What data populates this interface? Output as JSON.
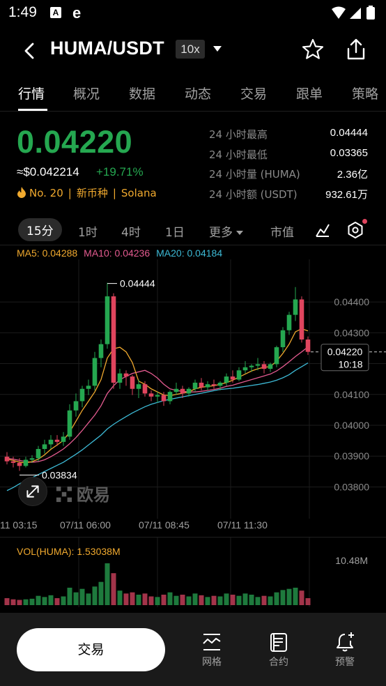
{
  "status_bar": {
    "time": "1:49",
    "icon_a": "A",
    "icon_e": "e"
  },
  "header": {
    "pair": "HUMA/USDT",
    "leverage": "10x"
  },
  "tabs": [
    "行情",
    "概况",
    "数据",
    "动态",
    "交易",
    "跟单",
    "策略"
  ],
  "price": {
    "last": "0.04220",
    "usd": "≈$0.042214",
    "change": "+19.71%",
    "rank": "No. 20",
    "tag": "新币种",
    "chain": "Solana"
  },
  "stats": [
    {
      "label": "24 小时最高",
      "value": "0.04444"
    },
    {
      "label": "24 小时最低",
      "value": "0.03365"
    },
    {
      "label": "24 小时量 (HUMA)",
      "value": "2.36亿"
    },
    {
      "label": "24 小时额 (USDT)",
      "value": "932.61万"
    }
  ],
  "intervals": {
    "i15m": "15分",
    "i1h": "1时",
    "i4h": "4时",
    "i1d": "1日",
    "more": "更多",
    "market": "市值"
  },
  "ma_legend": {
    "ma5": "MA5: 0.04288",
    "ma10": "MA10: 0.04236",
    "ma20": "MA20: 0.04184"
  },
  "watermark": "欧易",
  "price_axis": [
    "0.04400",
    "0.04300",
    "0.04100",
    "0.04000",
    "0.03900",
    "0.03800"
  ],
  "current_price_tag": {
    "price": "0.04220",
    "countdown": "10:18"
  },
  "high_marker": "0.04444",
  "low_marker": "0.03834",
  "time_axis": [
    "11 03:15",
    "07/11 06:00",
    "07/11 08:45",
    "07/11 11:30"
  ],
  "volume": {
    "legend": "VOL(HUMA): 1.53038M",
    "max": "10.48M"
  },
  "bottom": {
    "trade": "交易",
    "grid": "网格",
    "contract": "合约",
    "alert": "预警"
  },
  "colors": {
    "up": "#25a750",
    "down": "#e0455e",
    "ma5": "#f0a92e",
    "ma10": "#e45b90",
    "ma20": "#3dbad6"
  },
  "chart_data": {
    "type": "candlestick",
    "interval": "15分",
    "y_range": [
      0.0374,
      0.0452
    ],
    "candles": [
      {
        "o": 0.0388,
        "h": 0.03895,
        "l": 0.03855,
        "c": 0.03865
      },
      {
        "o": 0.03865,
        "h": 0.0388,
        "l": 0.03845,
        "c": 0.0386
      },
      {
        "o": 0.0386,
        "h": 0.03875,
        "l": 0.03834,
        "c": 0.0385
      },
      {
        "o": 0.0385,
        "h": 0.0388,
        "l": 0.03845,
        "c": 0.0387
      },
      {
        "o": 0.0387,
        "h": 0.03885,
        "l": 0.0386,
        "c": 0.03875
      },
      {
        "o": 0.03875,
        "h": 0.03915,
        "l": 0.03865,
        "c": 0.03905
      },
      {
        "o": 0.03905,
        "h": 0.03935,
        "l": 0.0389,
        "c": 0.0392
      },
      {
        "o": 0.0392,
        "h": 0.0395,
        "l": 0.03905,
        "c": 0.03935
      },
      {
        "o": 0.03935,
        "h": 0.0395,
        "l": 0.03915,
        "c": 0.03928
      },
      {
        "o": 0.03928,
        "h": 0.0396,
        "l": 0.03915,
        "c": 0.03945
      },
      {
        "o": 0.03945,
        "h": 0.0405,
        "l": 0.03935,
        "c": 0.0403
      },
      {
        "o": 0.0403,
        "h": 0.04085,
        "l": 0.0401,
        "c": 0.0406
      },
      {
        "o": 0.0406,
        "h": 0.0411,
        "l": 0.0404,
        "c": 0.041
      },
      {
        "o": 0.041,
        "h": 0.0413,
        "l": 0.0408,
        "c": 0.0411
      },
      {
        "o": 0.0411,
        "h": 0.0422,
        "l": 0.04095,
        "c": 0.042
      },
      {
        "o": 0.042,
        "h": 0.0426,
        "l": 0.0417,
        "c": 0.04245
      },
      {
        "o": 0.04245,
        "h": 0.04444,
        "l": 0.0423,
        "c": 0.044
      },
      {
        "o": 0.044,
        "h": 0.0441,
        "l": 0.041,
        "c": 0.0412
      },
      {
        "o": 0.0412,
        "h": 0.04165,
        "l": 0.041,
        "c": 0.0415
      },
      {
        "o": 0.0415,
        "h": 0.0416,
        "l": 0.0411,
        "c": 0.0414
      },
      {
        "o": 0.0414,
        "h": 0.04145,
        "l": 0.0408,
        "c": 0.041
      },
      {
        "o": 0.041,
        "h": 0.0413,
        "l": 0.0407,
        "c": 0.04115
      },
      {
        "o": 0.04115,
        "h": 0.04125,
        "l": 0.04075,
        "c": 0.04085
      },
      {
        "o": 0.04085,
        "h": 0.04095,
        "l": 0.0406,
        "c": 0.04075
      },
      {
        "o": 0.04075,
        "h": 0.0409,
        "l": 0.04055,
        "c": 0.0408
      },
      {
        "o": 0.0408,
        "h": 0.0409,
        "l": 0.04045,
        "c": 0.0406
      },
      {
        "o": 0.0406,
        "h": 0.04095,
        "l": 0.0405,
        "c": 0.0409
      },
      {
        "o": 0.0409,
        "h": 0.0412,
        "l": 0.0408,
        "c": 0.041
      },
      {
        "o": 0.041,
        "h": 0.0411,
        "l": 0.0407,
        "c": 0.04085
      },
      {
        "o": 0.04085,
        "h": 0.04105,
        "l": 0.04075,
        "c": 0.041
      },
      {
        "o": 0.041,
        "h": 0.0413,
        "l": 0.0409,
        "c": 0.0412
      },
      {
        "o": 0.0412,
        "h": 0.04135,
        "l": 0.04095,
        "c": 0.04105
      },
      {
        "o": 0.04105,
        "h": 0.04125,
        "l": 0.04095,
        "c": 0.04115
      },
      {
        "o": 0.04115,
        "h": 0.0413,
        "l": 0.041,
        "c": 0.0411
      },
      {
        "o": 0.0411,
        "h": 0.04125,
        "l": 0.04095,
        "c": 0.0412
      },
      {
        "o": 0.0412,
        "h": 0.0415,
        "l": 0.0411,
        "c": 0.0414
      },
      {
        "o": 0.0414,
        "h": 0.0416,
        "l": 0.0412,
        "c": 0.0413
      },
      {
        "o": 0.0413,
        "h": 0.0417,
        "l": 0.04125,
        "c": 0.0416
      },
      {
        "o": 0.0416,
        "h": 0.0419,
        "l": 0.0415,
        "c": 0.0417
      },
      {
        "o": 0.0417,
        "h": 0.0418,
        "l": 0.04155,
        "c": 0.04175
      },
      {
        "o": 0.04175,
        "h": 0.042,
        "l": 0.0416,
        "c": 0.0418
      },
      {
        "o": 0.0418,
        "h": 0.0419,
        "l": 0.0415,
        "c": 0.04165
      },
      {
        "o": 0.04165,
        "h": 0.04185,
        "l": 0.04155,
        "c": 0.0418
      },
      {
        "o": 0.0418,
        "h": 0.0424,
        "l": 0.0417,
        "c": 0.04235
      },
      {
        "o": 0.04235,
        "h": 0.043,
        "l": 0.0422,
        "c": 0.0429
      },
      {
        "o": 0.0429,
        "h": 0.0435,
        "l": 0.04275,
        "c": 0.0434
      },
      {
        "o": 0.0434,
        "h": 0.0443,
        "l": 0.0432,
        "c": 0.0439
      },
      {
        "o": 0.0439,
        "h": 0.044,
        "l": 0.0425,
        "c": 0.0426
      },
      {
        "o": 0.0426,
        "h": 0.0427,
        "l": 0.0421,
        "c": 0.0422
      }
    ],
    "ma5": [
      0.03872,
      0.03868,
      0.03862,
      0.0386,
      0.03864,
      0.03872,
      0.03886,
      0.03904,
      0.03918,
      0.03933,
      0.0396,
      0.03995,
      0.0403,
      0.0406,
      0.0409,
      0.0413,
      0.042,
      0.0423,
      0.04235,
      0.0422,
      0.04185,
      0.04125,
      0.04115,
      0.041,
      0.0409,
      0.0408,
      0.04078,
      0.04082,
      0.04086,
      0.0409,
      0.041,
      0.04105,
      0.04108,
      0.0411,
      0.04115,
      0.0412,
      0.04128,
      0.04138,
      0.04148,
      0.04158,
      0.04165,
      0.0417,
      0.04172,
      0.0419,
      0.04215,
      0.04245,
      0.04285,
      0.04295,
      0.04288
    ],
    "ma10": [
      0.03875,
      0.03872,
      0.03868,
      0.03864,
      0.03862,
      0.03864,
      0.0387,
      0.0388,
      0.03892,
      0.03905,
      0.03922,
      0.03942,
      0.03965,
      0.0399,
      0.04015,
      0.04045,
      0.04085,
      0.0411,
      0.0413,
      0.0414,
      0.0415,
      0.04155,
      0.0416,
      0.0415,
      0.04135,
      0.04115,
      0.041,
      0.04095,
      0.04092,
      0.0409,
      0.0409,
      0.04092,
      0.04095,
      0.04098,
      0.04102,
      0.04108,
      0.04112,
      0.04118,
      0.04124,
      0.0413,
      0.04136,
      0.04142,
      0.04148,
      0.04158,
      0.04172,
      0.04188,
      0.04205,
      0.0422,
      0.04236
    ],
    "ma20": [
      0.0377,
      0.0378,
      0.03792,
      0.03802,
      0.03812,
      0.03822,
      0.03832,
      0.03842,
      0.03852,
      0.03862,
      0.03875,
      0.03888,
      0.03902,
      0.03918,
      0.03934,
      0.0395,
      0.0397,
      0.03985,
      0.03998,
      0.0401,
      0.04022,
      0.04032,
      0.04042,
      0.0405,
      0.04056,
      0.04062,
      0.04066,
      0.0407,
      0.04074,
      0.04078,
      0.04082,
      0.04086,
      0.0409,
      0.04094,
      0.04098,
      0.041,
      0.04102,
      0.04105,
      0.04108,
      0.04111,
      0.04114,
      0.04118,
      0.04122,
      0.04128,
      0.04136,
      0.04146,
      0.0416,
      0.04172,
      0.04184
    ],
    "volumes": [
      0.12,
      0.1,
      0.09,
      0.1,
      0.11,
      0.16,
      0.14,
      0.17,
      0.12,
      0.15,
      0.3,
      0.22,
      0.28,
      0.2,
      0.32,
      0.4,
      0.72,
      0.55,
      0.25,
      0.2,
      0.22,
      0.18,
      0.2,
      0.15,
      0.14,
      0.18,
      0.22,
      0.16,
      0.18,
      0.15,
      0.2,
      0.17,
      0.14,
      0.16,
      0.15,
      0.2,
      0.18,
      0.16,
      0.2,
      0.18,
      0.14,
      0.16,
      0.15,
      0.22,
      0.26,
      0.28,
      0.3,
      0.25,
      0.12
    ]
  }
}
